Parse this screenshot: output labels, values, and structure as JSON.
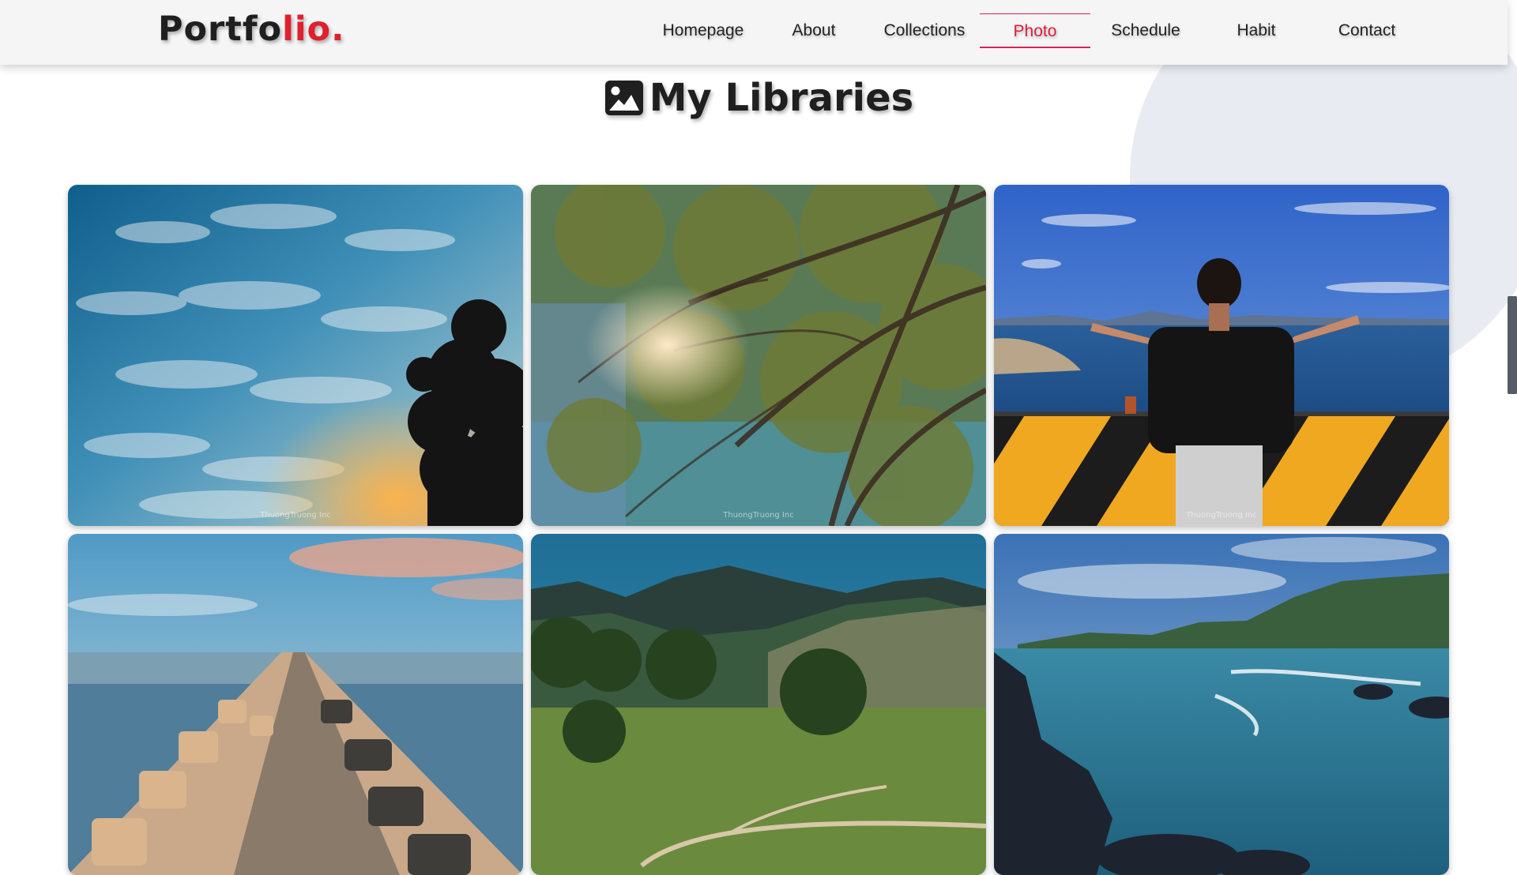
{
  "brand": {
    "name_main": "Portfo",
    "name_accent": "lio."
  },
  "nav": {
    "items": [
      {
        "label": "Homepage"
      },
      {
        "label": "About"
      },
      {
        "label": "Collections"
      },
      {
        "label": "Photo",
        "active": true
      },
      {
        "label": "Schedule"
      },
      {
        "label": "Habit"
      },
      {
        "label": "Contact"
      }
    ]
  },
  "page": {
    "heading": "My Libraries",
    "heading_icon": "image-icon"
  },
  "gallery": {
    "watermark": "ThuongTruong Inc",
    "photos": [
      {
        "subject": "sky-clouds-tree-silhouette",
        "watermark": true
      },
      {
        "subject": "tree-canopy-sun",
        "watermark": true
      },
      {
        "subject": "man-arms-outstretched-sea",
        "watermark": true
      },
      {
        "subject": "breakwater-pier",
        "watermark": false
      },
      {
        "subject": "mountain-valley",
        "watermark": false
      },
      {
        "subject": "rocky-coast-ocean",
        "watermark": false
      }
    ]
  },
  "colors": {
    "accent": "#e0202d",
    "active_underline": "#d8235a",
    "navbar_bg": "#f5f5f6",
    "text_dark": "#1f1f1f",
    "bg_circle": "#e9ebf2"
  }
}
